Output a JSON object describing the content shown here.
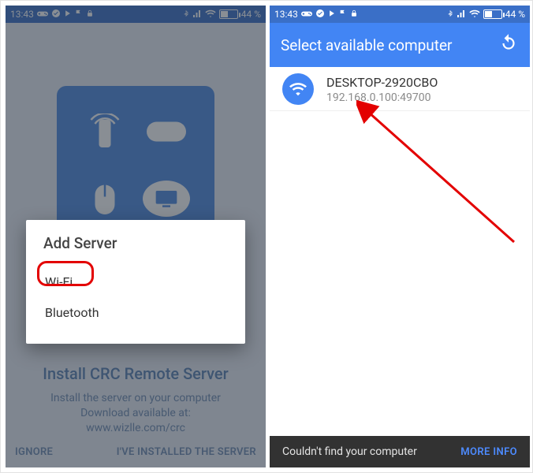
{
  "status": {
    "time": "13:43",
    "battery_text": "44 %"
  },
  "left": {
    "install_title": "Install CRC Remote Server",
    "install_line1": "Install the server on your computer",
    "install_line2": "Download available at:",
    "install_url": "www.wizlle.com/crc",
    "ignore": "IGNORE",
    "installed": "I'VE INSTALLED THE SERVER",
    "dialog_title": "Add Server",
    "opt_wifi": "Wi-Fi",
    "opt_bt": "Bluetooth"
  },
  "right": {
    "appbar_title": "Select available computer",
    "item_name": "DESKTOP-2920CBO",
    "item_ip": "192.168.0.100:49700",
    "snackbar_text": "Couldn't find your computer",
    "snackbar_action": "MORE INFO"
  }
}
